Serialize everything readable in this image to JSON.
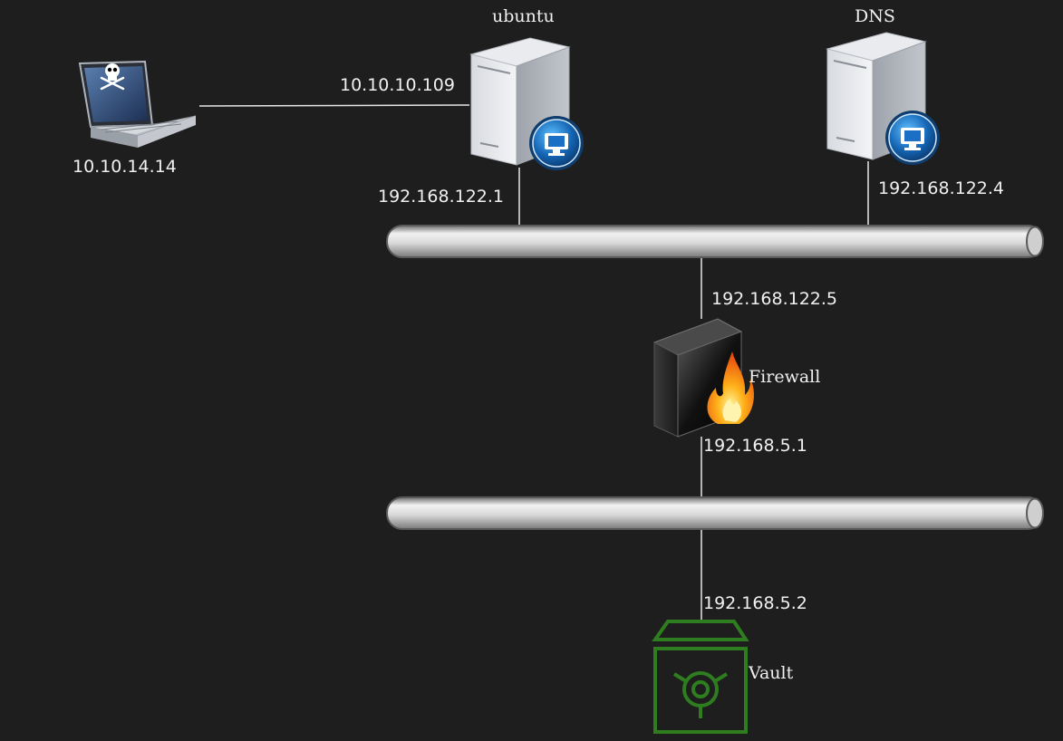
{
  "nodes": {
    "attacker": {
      "ip": "10.10.14.14",
      "icon": "hacker-laptop-icon"
    },
    "ubuntu": {
      "name": "ubuntu",
      "external_ip": "10.10.10.109",
      "internal_ip": "192.168.122.1",
      "icon": "server-icon"
    },
    "dns": {
      "name": "DNS",
      "ip": "192.168.122.4",
      "icon": "server-icon"
    },
    "firewall": {
      "name": "Firewall",
      "outer_ip": "192.168.122.5",
      "inner_ip": "192.168.5.1",
      "icon": "firewall-icon"
    },
    "vault": {
      "name": "Vault",
      "ip": "192.168.5.2",
      "icon": "vault-icon"
    }
  },
  "colors": {
    "background": "#1e1e1e",
    "text": "#f0f0f0",
    "link": "#e6e6e6",
    "vault": "#2e7d1e"
  }
}
